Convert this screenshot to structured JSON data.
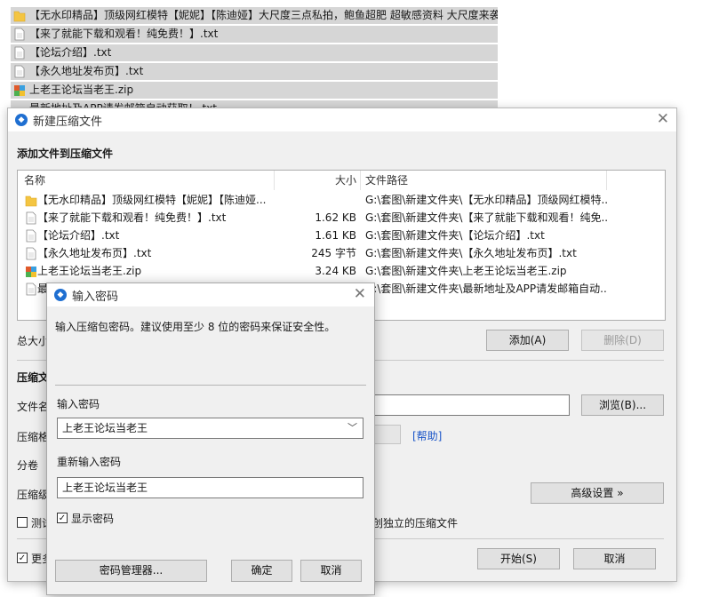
{
  "background_list": {
    "items": [
      {
        "label": "【无水印精品】顶级网红模特【妮妮】【陈迪娅】大尺度三点私拍，鲍鱼超肥 超敏感资料 大尺度来袭",
        "icon": "folder-icon"
      },
      {
        "label": "【来了就能下载和观看！纯免费！】.txt",
        "icon": "text-file-icon"
      },
      {
        "label": "【论坛介绍】.txt",
        "icon": "text-file-icon"
      },
      {
        "label": "【永久地址发布页】.txt",
        "icon": "text-file-icon"
      },
      {
        "label": "上老王论坛当老王.zip",
        "icon": "zip-archive-icon"
      },
      {
        "label": "最新地址及APP请发邮箱自动获取！.txt",
        "icon": "text-file-icon"
      }
    ]
  },
  "main_window": {
    "title": "新建压缩文件",
    "add_section_title": "添加文件到压缩文件",
    "columns": {
      "name": "名称",
      "size": "大小",
      "path": "文件路径"
    },
    "files": [
      {
        "name": "【无水印精品】顶级网红模特【妮妮】【陈迪娅...",
        "size": "",
        "path": "G:\\套图\\新建文件夹\\【无水印精品】顶级网红模特...",
        "icon": "folder-icon"
      },
      {
        "name": "【来了就能下载和观看！纯免费！】.txt",
        "size": "1.62 KB",
        "path": "G:\\套图\\新建文件夹\\【来了就能下载和观看！纯免...",
        "icon": "text-file-icon"
      },
      {
        "name": "【论坛介绍】.txt",
        "size": "1.61 KB",
        "path": "G:\\套图\\新建文件夹\\【论坛介绍】.txt",
        "icon": "text-file-icon"
      },
      {
        "name": "【永久地址发布页】.txt",
        "size": "245 字节",
        "path": "G:\\套图\\新建文件夹\\【永久地址发布页】.txt",
        "icon": "text-file-icon"
      },
      {
        "name": "上老王论坛当老王.zip",
        "size": "3.24 KB",
        "path": "G:\\套图\\新建文件夹\\上老王论坛当老王.zip",
        "icon": "zip-archive-icon"
      },
      {
        "name": "最",
        "size": "",
        "path": "G:\\套图\\新建文件夹\\最新地址及APP请发邮箱自动...",
        "icon": "text-file-icon"
      }
    ],
    "total_size_label": "总大小",
    "add_button": "添加(A)",
    "delete_button": "删除(D)",
    "compress_section_label": "压缩文",
    "filename_label": "文件名",
    "browse_button": "浏览(B)...",
    "format_label": "压缩格",
    "help_link": "[帮助]",
    "split_label": "分卷",
    "level_label": "压缩级",
    "advanced_button": "高级设置 »",
    "test_checkbox_label": "测试",
    "independent_label": "创独立的压缩文件",
    "more_checkbox_label": "更多",
    "start_button": "开始(S)",
    "cancel_button": "取消"
  },
  "password_dialog": {
    "title": "输入密码",
    "description": "输入压缩包密码。建议使用至少 8 位的密码来保证安全性。",
    "password_label": "输入密码",
    "password_value": "上老王论坛当老王",
    "confirm_label": "重新输入密码",
    "confirm_value": "上老王论坛当老王",
    "show_password_label": "显示密码",
    "show_password_checked": true,
    "manager_button": "密码管理器...",
    "ok_button": "确定",
    "cancel_button": "取消"
  },
  "colors": {
    "accent": "#1f6fd1",
    "link": "#1a55c8",
    "selection_bg": "#d6d6d6",
    "folder": "#f4c542"
  }
}
